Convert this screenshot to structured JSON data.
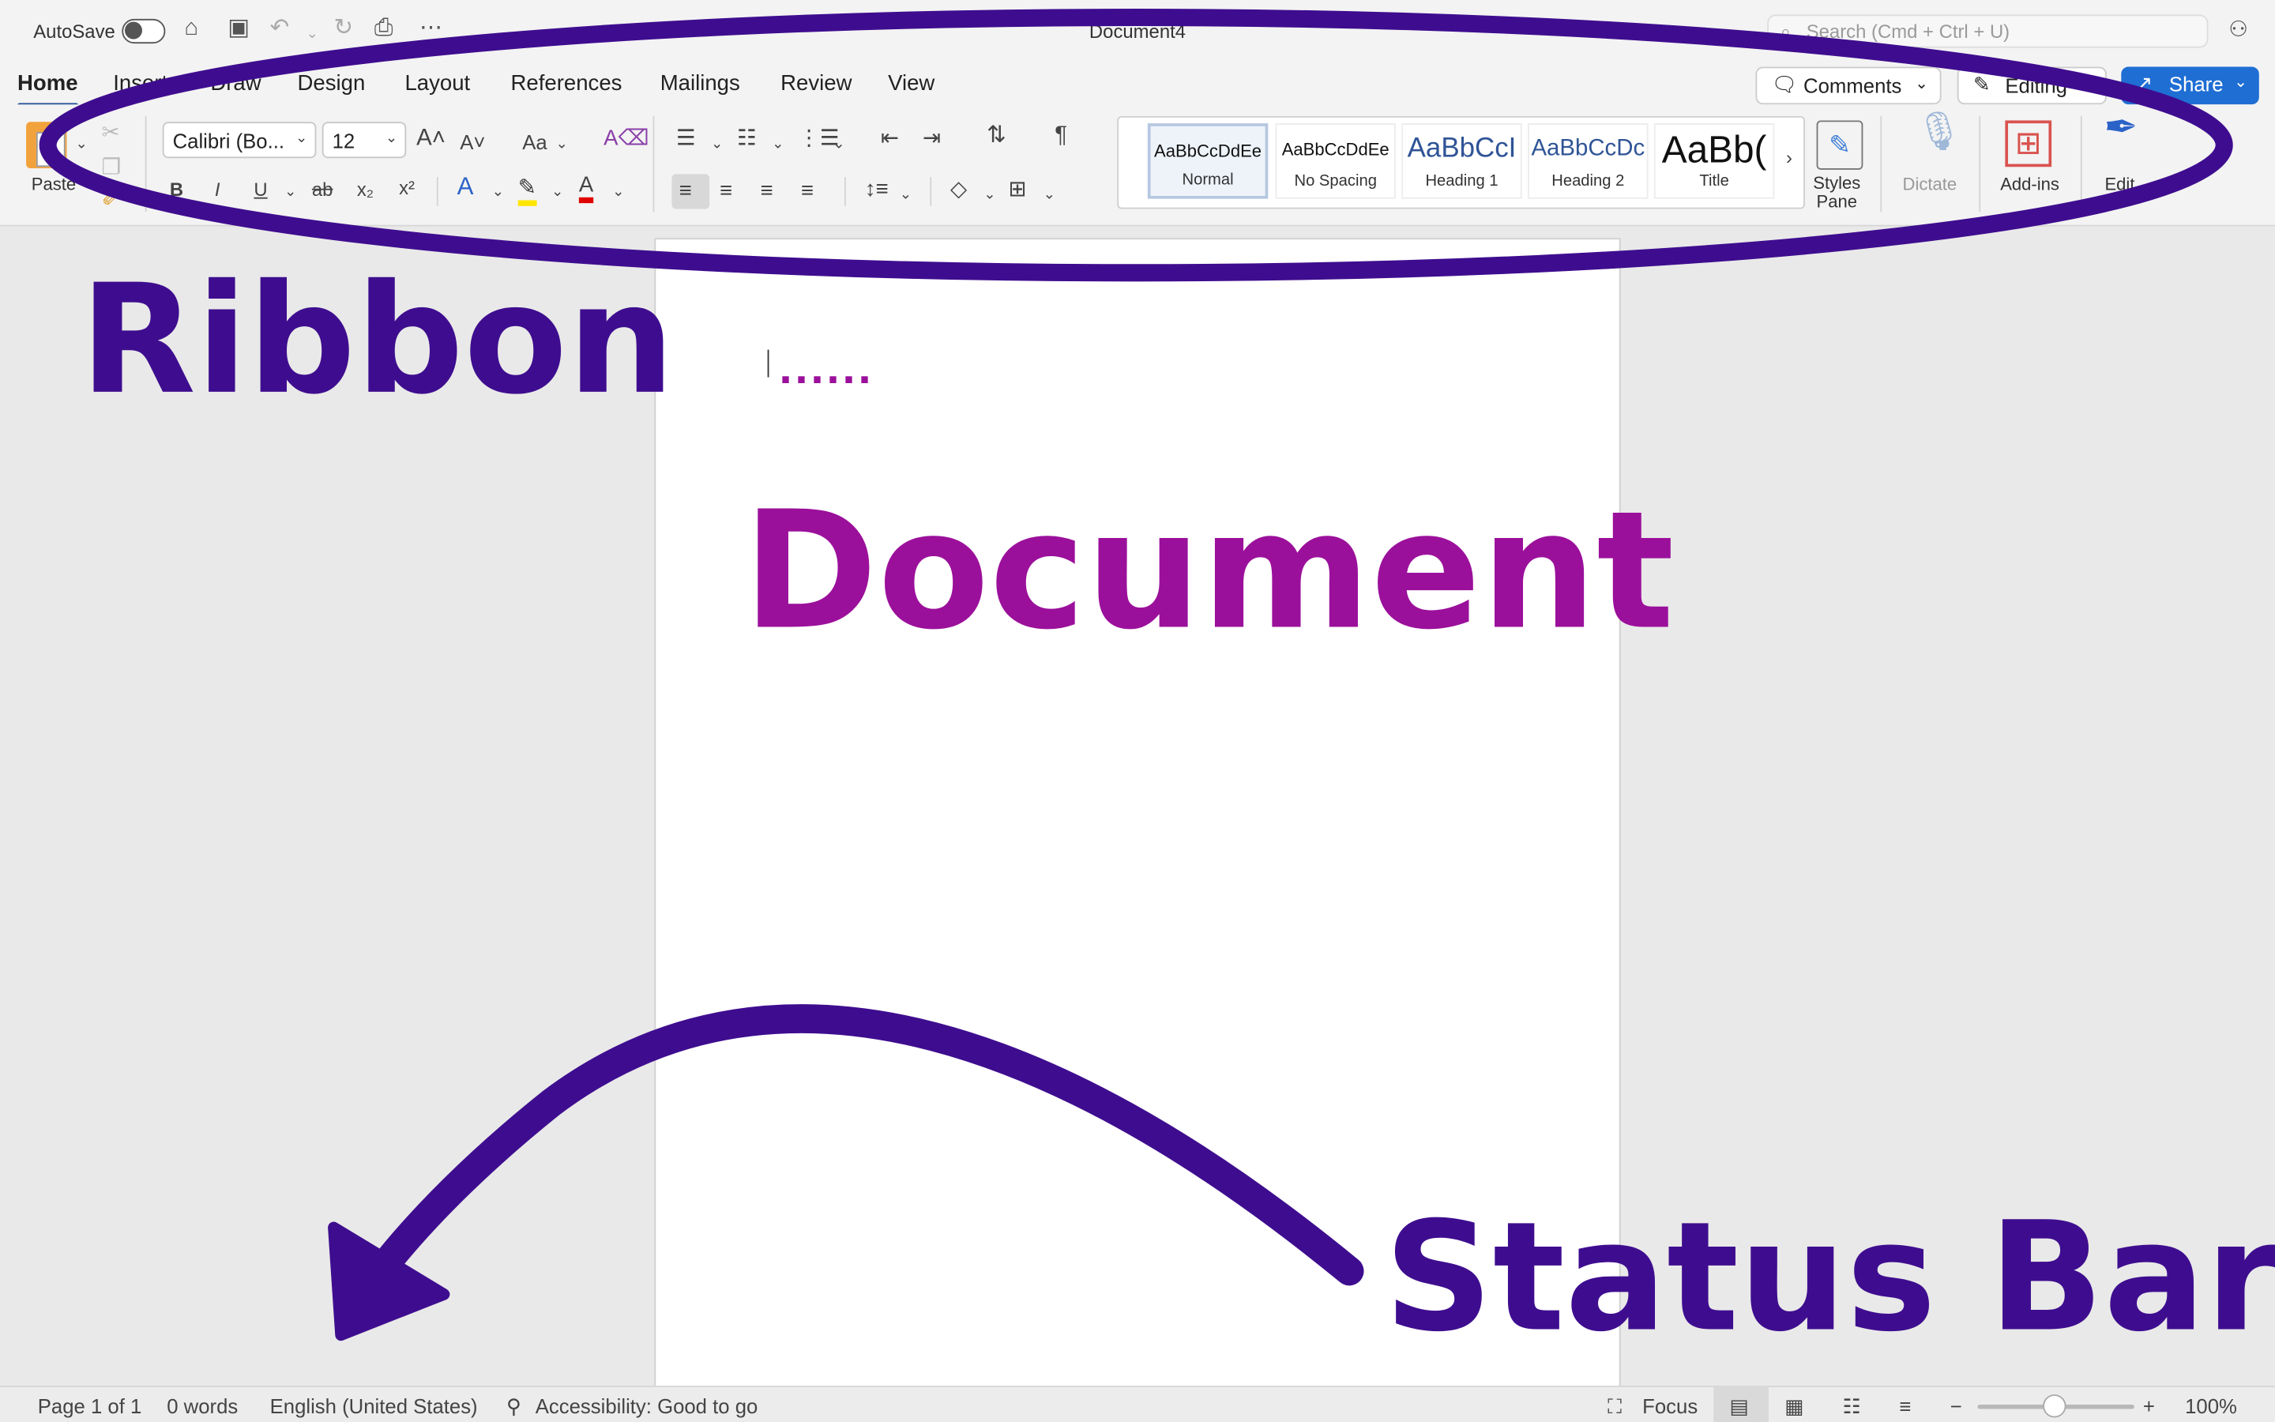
{
  "window": {
    "title": "Document4",
    "autosave_label": "AutoSave",
    "search_placeholder": "Search (Cmd + Ctrl + U)"
  },
  "tabs": [
    "Home",
    "Insert",
    "Draw",
    "Design",
    "Layout",
    "References",
    "Mailings",
    "Review",
    "View"
  ],
  "tab_buttons": {
    "comments": "Comments",
    "editing": "Editing",
    "share": "Share"
  },
  "ribbon": {
    "paste_label": "Paste",
    "font_name": "Calibri (Bo...",
    "font_size": "12",
    "change_case": "Aa",
    "styles": [
      {
        "sample": "AaBbCcDdEe",
        "name": "Normal"
      },
      {
        "sample": "AaBbCcDdEe",
        "name": "No Spacing"
      },
      {
        "sample": "AaBbCcI",
        "name": "Heading 1"
      },
      {
        "sample": "AaBbCcDc",
        "name": "Heading 2"
      },
      {
        "sample": "AaBb(",
        "name": "Title"
      }
    ],
    "styles_pane_label": "Styles\nPane",
    "dictate_label": "Dictate",
    "addins_label": "Add-ins",
    "editor_label": "Edit"
  },
  "document": {
    "dots": "......"
  },
  "statusbar": {
    "page": "Page 1 of 1",
    "words": "0 words",
    "language": "English (United States)",
    "accessibility": "Accessibility: Good to go",
    "focus": "Focus",
    "zoom": "100%"
  },
  "annotations": {
    "ribbon": "Ribbon",
    "document": "Document",
    "status_bar": "Status Bar",
    "colors": {
      "ribbon_label": "#3e0d8f",
      "document_label": "#9b109b",
      "status_label": "#3e0d8f"
    }
  },
  "colors": {
    "share_button": "#1f6ed4",
    "active_tab_underline": "#2b579a"
  }
}
